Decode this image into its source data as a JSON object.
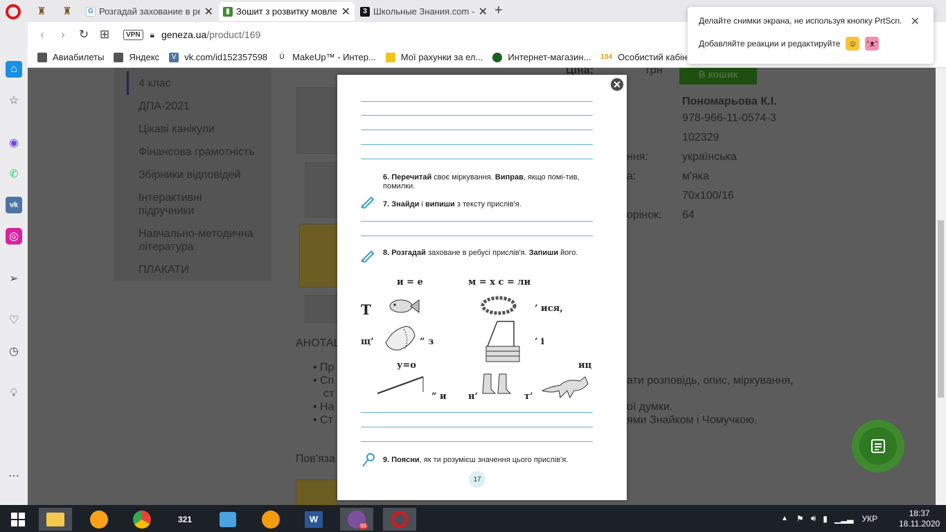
{
  "tabs": [
    {
      "title": "Розгадай захование в ребу",
      "icon": "google-icon"
    },
    {
      "title": "Зошит з розвитку мовлен",
      "icon": "geneza-icon"
    },
    {
      "title": "Школьные Знания.com - Р",
      "icon": "znanija-icon"
    }
  ],
  "address": {
    "vpn": "VPN",
    "host": "geneza.ua",
    "path": "/product/169"
  },
  "bookmarks": [
    "Авиабилеты",
    "Яндекс",
    "vk.com/id152357598",
    "MakeUp™ - Интер...",
    "Мої рахунки за ел...",
    "Интернет-магазин...",
    "Особистий кабінет..."
  ],
  "bookmark_badge": "104",
  "menu": [
    "4 клас",
    "ДПА-2021",
    "Цікаві канікули",
    "Фінансова грамотність",
    "Збірники відповідей",
    "Інтерактивні підручники",
    "Навчально-методична література",
    "ПЛАКАТИ"
  ],
  "product": {
    "price_label": "Ціна:",
    "currency": "грн",
    "buy_label": "В кошик",
    "author": "Пономарьова К.І.",
    "isbn": "978-966-11-0574-3",
    "code": "102329",
    "language_label": "ння:",
    "language": "українська",
    "cover_label": "а:",
    "cover": "м'яка",
    "format": "70x100/16",
    "pages_label": "орінок:",
    "pages": "64"
  },
  "annotation": {
    "heading": "АНОТАЦ",
    "b1": "Пр",
    "b2": "Сп",
    "b2_tail": "ати розповідь, опис, міркування,",
    "b2_line2": "ст",
    "b3": "На",
    "b3_tail": "ої думки.",
    "b4": "Ст",
    "b4_tail": "ями Знайком і Чомучкою.",
    "related": "Пов'яза"
  },
  "worksheet": {
    "task6_bold1": "6. Перечитай",
    "task6_text1": " своє міркування. ",
    "task6_bold2": "Виправ",
    "task6_text2": ", якщо помі-тив, помилки.",
    "task7_bold1": "7. Знайди",
    "task7_text1": " і ",
    "task7_bold2": "випиши",
    "task7_text2": " з тексту прислів'я.",
    "task8_bold1": "8. Розгадай",
    "task8_text1": " заховане в ребусі прислів'я. ",
    "task8_bold2": "Запиши",
    "task8_text2": " його.",
    "task9_bold": "9. Поясни",
    "task9_text": ", як ти розумієш значення цього прислів'я.",
    "page_number": "17",
    "rebus": {
      "hint1": "и = е",
      "hint2": "м = х   с = ли",
      "t_letter": "Т",
      "r1_end": "’ ися,",
      "r2_start": "щ’",
      "r2_mid": "” з",
      "r2_end": "’ і",
      "hint3": "у=о",
      "hint4": "иц",
      "r3_a": "” и",
      "r3_b": "н’",
      "r3_c": "т’"
    }
  },
  "notification": {
    "line1": "Делайте снимки экрана, не используя кнопку PrtScn.",
    "line2": "Добавляйте реакции и редактируйте"
  },
  "taskbar": {
    "lang": "УКР",
    "time": "18:37",
    "date": "18.11.2020",
    "viber_badge": "99"
  },
  "colors": {
    "accent": "#5eb2d6",
    "fab": "#3f8a2e",
    "price": "#e05a1a"
  }
}
